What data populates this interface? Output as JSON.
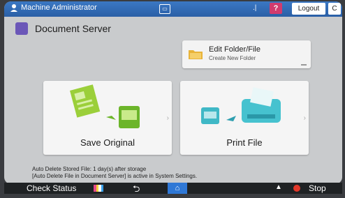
{
  "topbar": {
    "user_name": "Machine Administrator",
    "help_label": "?",
    "logout_label": "Logout",
    "power_label": "C"
  },
  "app": {
    "title": "Document Server",
    "icon": "document-server-icon"
  },
  "edit_folder": {
    "title": "Edit Folder/File",
    "subtitle": "Create New Folder"
  },
  "tiles": {
    "save": {
      "label": "Save Original"
    },
    "print": {
      "label": "Print File"
    }
  },
  "notice": {
    "line1": "Auto Delete Stored File: 1 day(s) after storage",
    "line2": "[Auto Delete File in Document Server] is active in System Settings."
  },
  "bottombar": {
    "check_status": "Check Status",
    "stop": "Stop"
  },
  "colors": {
    "topbar": "#2a5fa6",
    "help": "#d13b6e",
    "home": "#2f78d6",
    "stop": "#e2382a"
  }
}
